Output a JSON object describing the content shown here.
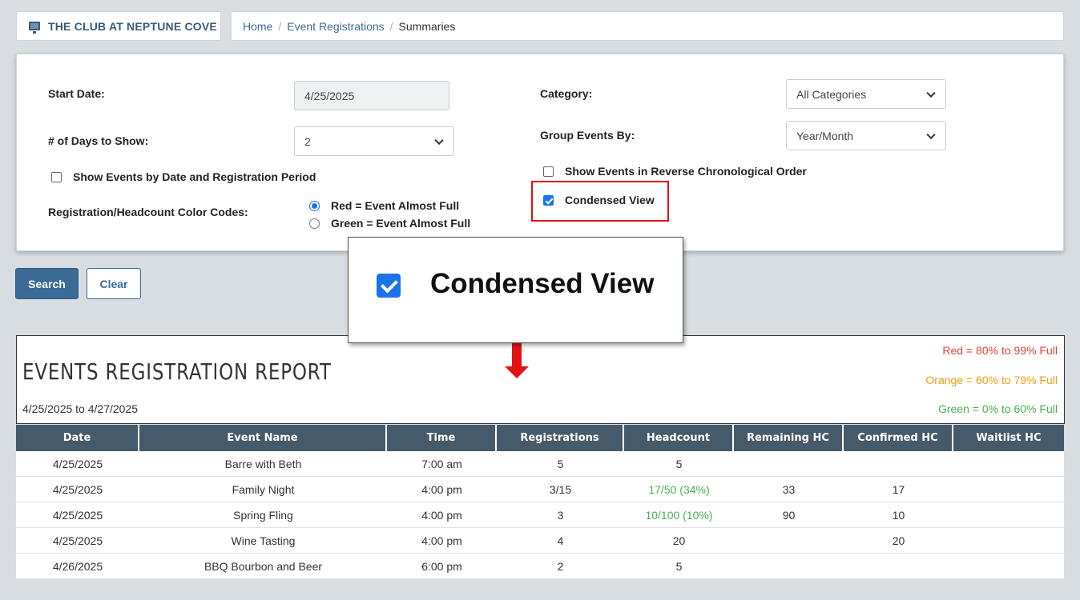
{
  "header": {
    "club_name": "THE CLUB AT NEPTUNE COVE",
    "breadcrumb": {
      "home": "Home",
      "events": "Event Registrations",
      "current": "Summaries",
      "separator": "/"
    }
  },
  "filters": {
    "start_date_label": "Start Date:",
    "start_date_value": "4/25/2025",
    "days_label": "# of Days to Show:",
    "days_value": "2",
    "show_by_date_label": "Show Events by Date and Registration Period",
    "color_codes_label": "Registration/Headcount Color Codes:",
    "radio_red": "Red = Event Almost Full",
    "radio_green": "Green = Event Almost Full",
    "category_label": "Category:",
    "category_value": "All Categories",
    "group_label": "Group Events By:",
    "group_value": "Year/Month",
    "reverse_label": "Show Events in Reverse Chronological Order",
    "condensed_label": "Condensed View"
  },
  "buttons": {
    "search": "Search",
    "clear": "Clear"
  },
  "zoom": {
    "label": "Condensed View"
  },
  "report": {
    "title": "EVENTS REGISTRATION REPORT",
    "range": "4/25/2025 to 4/27/2025",
    "legend_red": "Red = 80% to 99% Full",
    "legend_orange": "Orange = 60% to 79% Full",
    "legend_green": "Green = 0% to 60% Full",
    "colors": {
      "red": "#e0443a",
      "orange": "#f39c12",
      "green": "#4caf50"
    }
  },
  "table": {
    "headers": [
      "Date",
      "Event Name",
      "Time",
      "Registrations",
      "Headcount",
      "Remaining HC",
      "Confirmed HC",
      "Waitlist HC"
    ],
    "rows": [
      [
        "4/25/2025",
        "Barre with Beth",
        "7:00 am",
        "5",
        "5",
        "",
        "",
        ""
      ],
      [
        "4/25/2025",
        "Family Night",
        "4:00 pm",
        "3/15",
        "17/50 (34%)",
        "33",
        "17",
        ""
      ],
      [
        "4/25/2025",
        "Spring Fling",
        "4:00 pm",
        "3",
        "10/100 (10%)",
        "90",
        "10",
        ""
      ],
      [
        "4/25/2025",
        "Wine Tasting",
        "4:00 pm",
        "4",
        "20",
        "",
        "20",
        ""
      ],
      [
        "4/26/2025",
        "BBQ Bourbon and Beer",
        "6:00 pm",
        "2",
        "5",
        "",
        "",
        ""
      ]
    ]
  }
}
